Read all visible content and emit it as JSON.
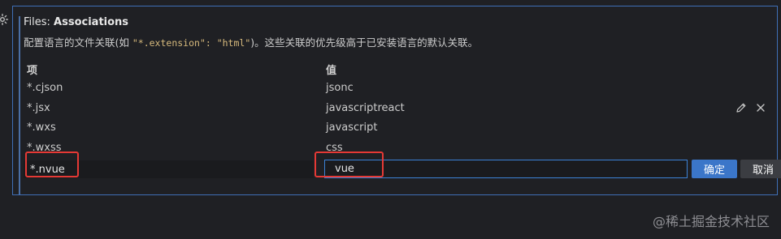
{
  "setting": {
    "title_prefix": "Files: ",
    "title_name": "Associations",
    "description_prefix": "配置语言的文件关联(如 ",
    "description_code": "\"*.extension\": \"html\"",
    "description_suffix": ")。这些关联的优先级高于已安装语言的默认关联。"
  },
  "table": {
    "header_key": "项",
    "header_value": "值",
    "rows": [
      {
        "key": "*.cjson",
        "value": "jsonc"
      },
      {
        "key": "*.jsx",
        "value": "javascriptreact"
      },
      {
        "key": "*.wxs",
        "value": "javascript"
      },
      {
        "key": "*.wxss",
        "value": "css"
      }
    ]
  },
  "edit": {
    "key_value": "*.nvue",
    "value_value": "vue",
    "ok_label": "确定",
    "cancel_label": "取消"
  },
  "watermark": "@稀土掘金技术社区",
  "colors": {
    "background": "#1f2024",
    "focus_border": "#3f6fb6",
    "primary_button": "#3b76c9",
    "annotation": "#e53935"
  },
  "icons": {
    "gear": "gear-icon",
    "edit": "pencil-icon",
    "remove": "close-icon"
  }
}
